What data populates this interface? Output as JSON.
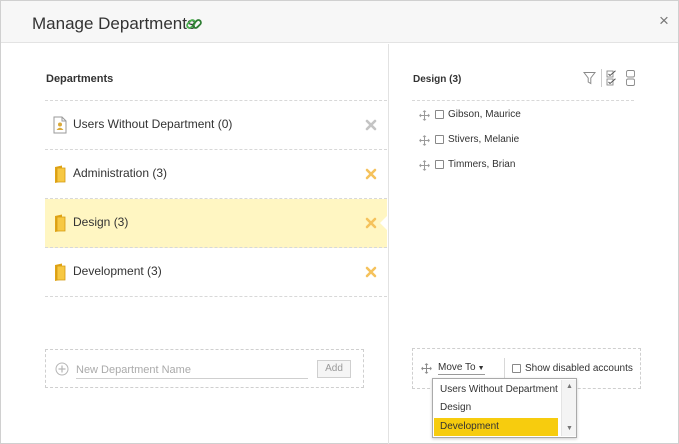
{
  "dialog": {
    "title": "Manage Departments",
    "close_glyph": "×"
  },
  "departments": {
    "title": "Departments",
    "items": [
      {
        "label": "Users Without Department (0)",
        "icon": "user-card-icon",
        "selected": false
      },
      {
        "label": "Administration (3)",
        "icon": "folder-icon",
        "selected": false
      },
      {
        "label": "Design (3)",
        "icon": "folder-icon",
        "selected": true
      },
      {
        "label": "Development (3)",
        "icon": "folder-icon",
        "selected": false
      }
    ],
    "new_placeholder": "New Department Name",
    "new_value": "",
    "add_label": "Add"
  },
  "members": {
    "title": "Design (3)",
    "list": [
      {
        "name": "Gibson, Maurice"
      },
      {
        "name": "Stivers, Melanie"
      },
      {
        "name": "Timmers, Brian"
      }
    ],
    "move_to_label": "Move To",
    "show_disabled_label": "Show disabled accounts"
  },
  "move_dropdown": {
    "options": [
      "Users Without Department",
      "Design",
      "Development"
    ],
    "highlighted": "Development"
  },
  "colors": {
    "selected_row": "#fff6c2",
    "remove_icon": "#f5c25c",
    "remove_icon_disabled": "#c4c4c4",
    "dropdown_highlight": "#f7cc0e",
    "link_icon": "#4caf50",
    "folder": "#f2b51f"
  }
}
